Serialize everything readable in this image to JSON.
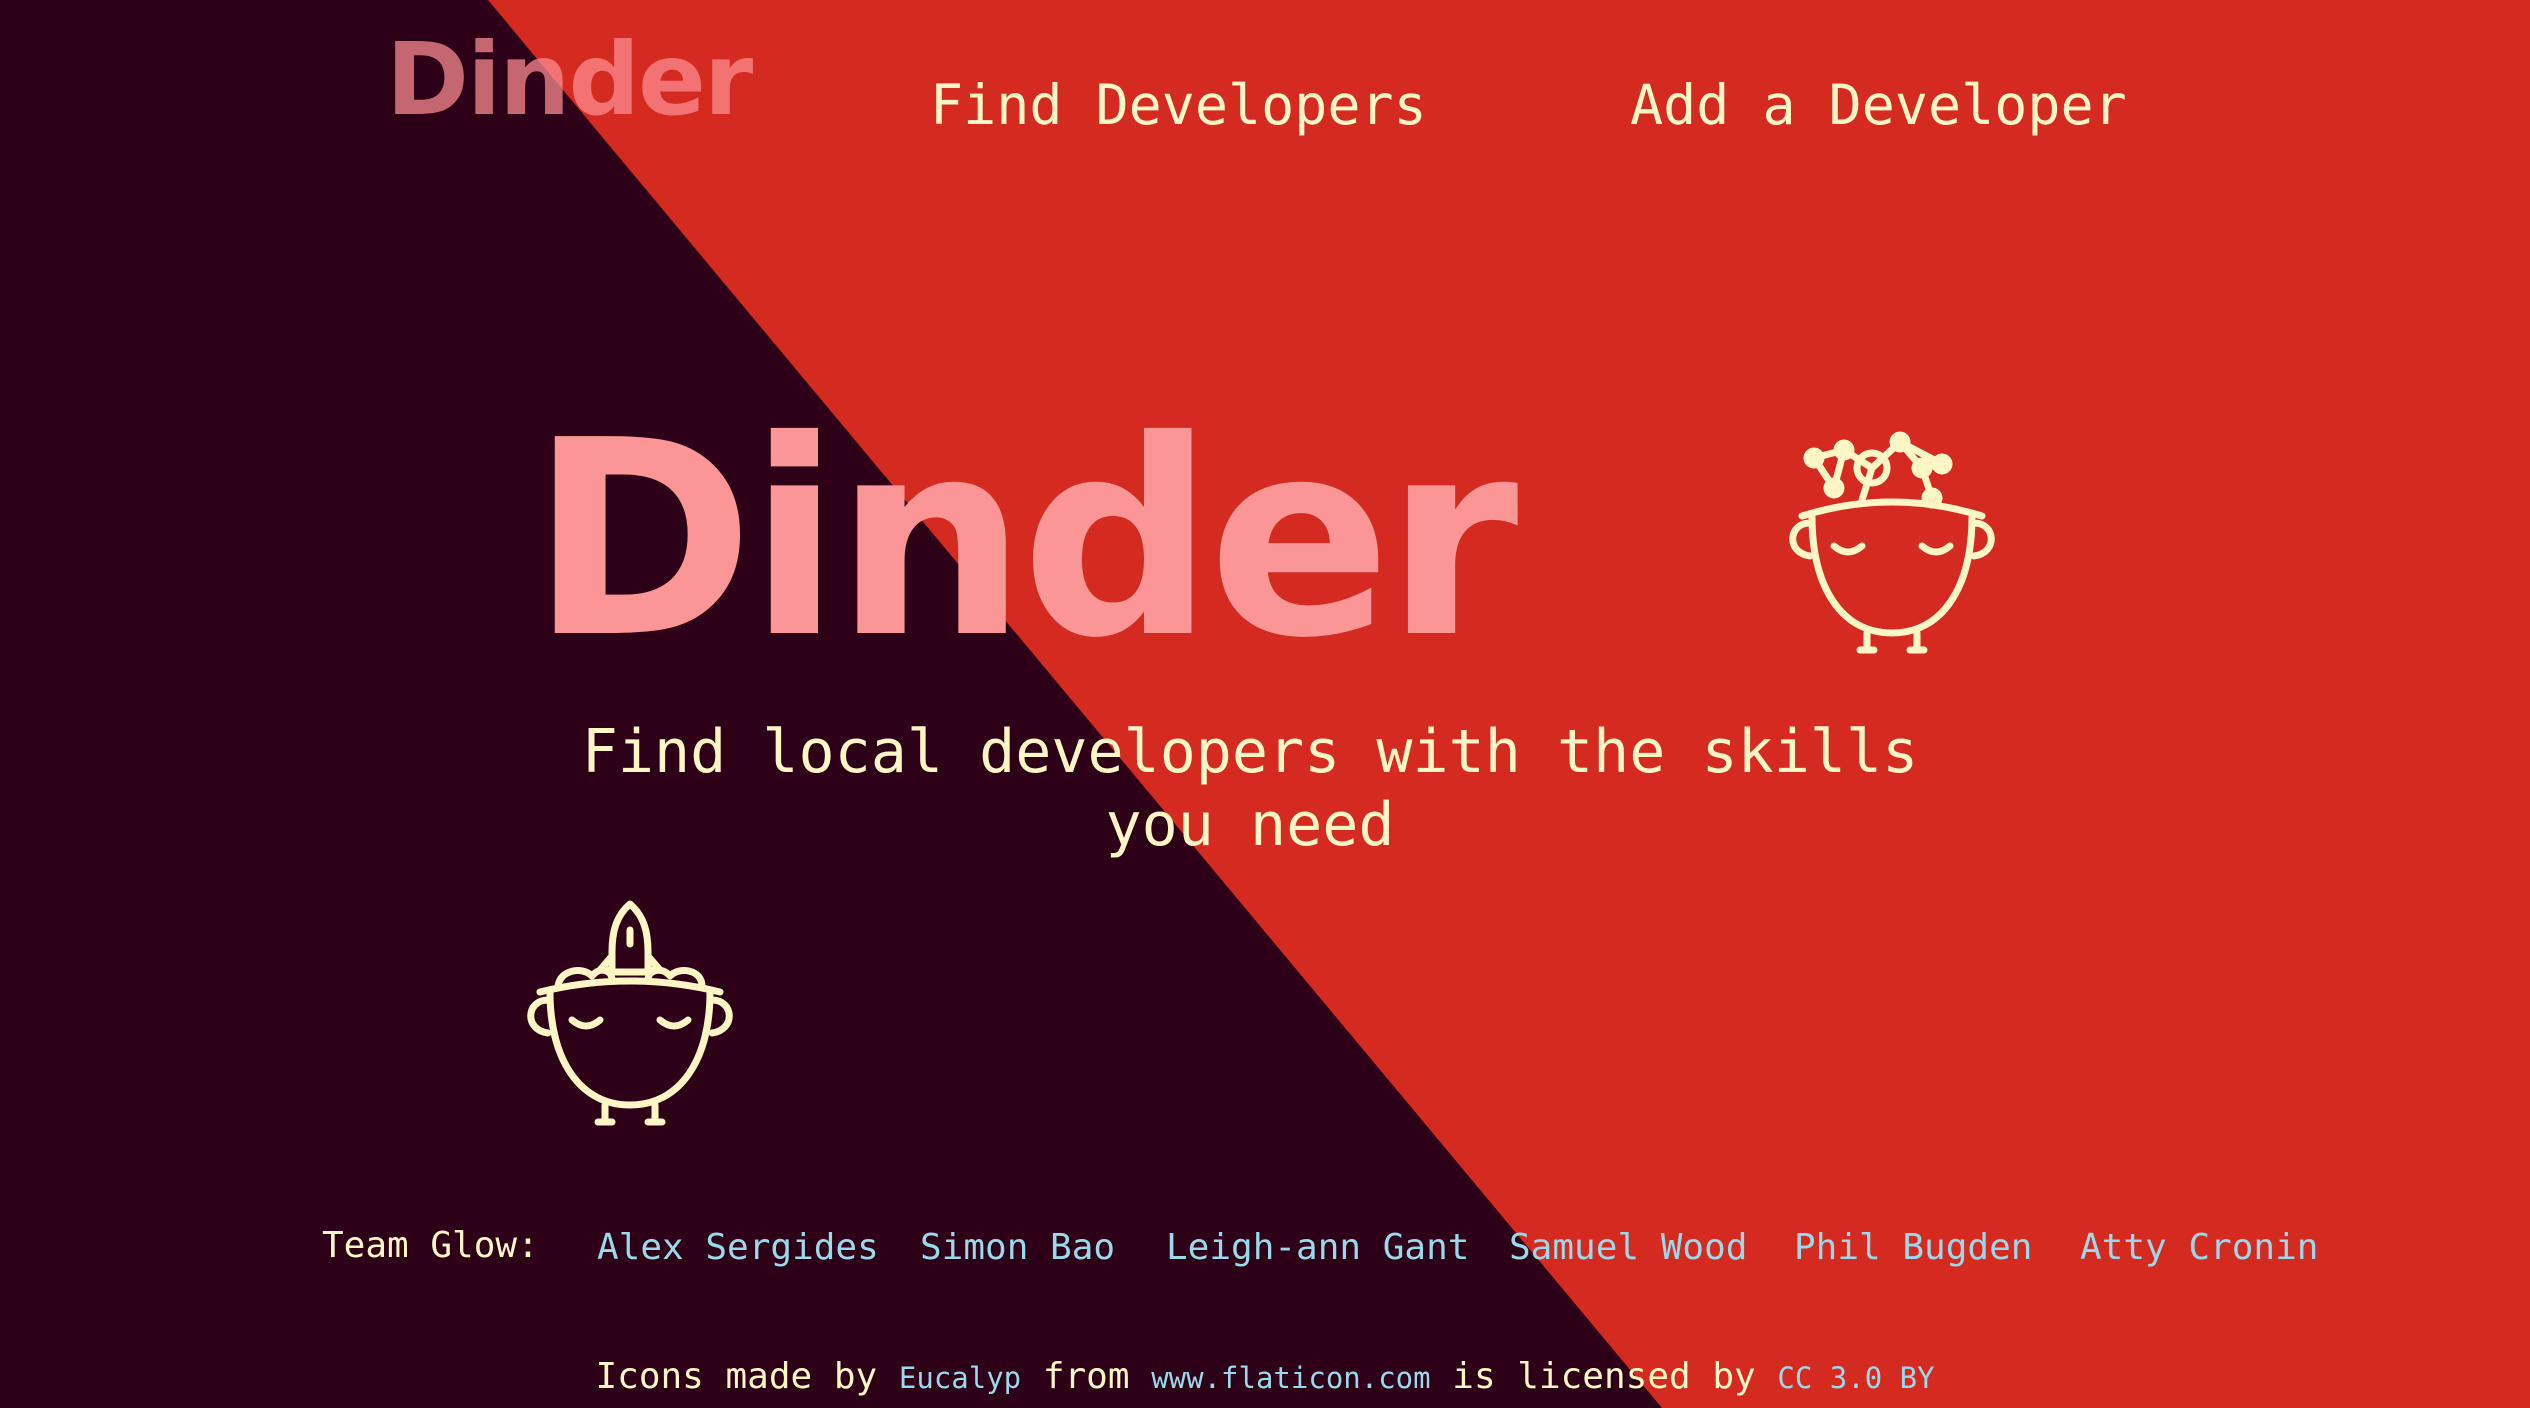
{
  "app": {
    "logo_small": "Dinder",
    "logo_big": "Dinder"
  },
  "nav": {
    "find_developers": "Find Developers",
    "add_developer": "Add a Developer"
  },
  "hero": {
    "tagline": "Find local developers with the skills you need"
  },
  "icons": {
    "right": "brain-network-head-icon",
    "left": "rocket-head-icon"
  },
  "team": {
    "label": "Team Glow:",
    "members": [
      "Alex Sergides",
      "Simon Bao",
      "Leigh-ann Gant",
      "Samuel Wood",
      "Phil Bugden",
      "Atty Cronin"
    ]
  },
  "credits": {
    "prefix": "Icons made by",
    "author": "Eucalyp",
    "from": "from",
    "site": "www.flaticon.com",
    "licensed": "is licensed by",
    "license": "CC 3.0 BY"
  },
  "colors": {
    "dark_bg": "#2d0018",
    "red_bg": "#d42a20",
    "cream": "#fff6c6",
    "pink_logo": "#fc9696",
    "link": "#9ad8ea"
  }
}
